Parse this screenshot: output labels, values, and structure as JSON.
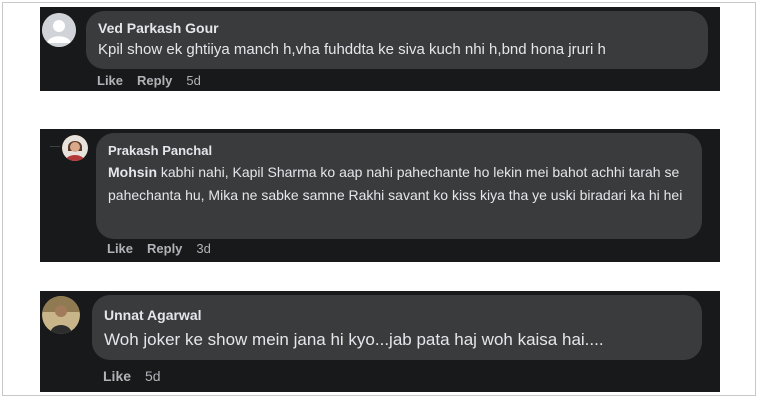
{
  "comments": [
    {
      "author": "Ved Parkash Gour",
      "text": "Kpil show ek ghtiiya manch h,vha fuhddta ke siva kuch nhi h,bnd hona jruri h",
      "like": "Like",
      "reply": "Reply",
      "time": "5d",
      "avatar_icon": "default-avatar-icon"
    },
    {
      "author": "Prakash Panchal",
      "mention": "Mohsin",
      "text": " kabhi nahi, Kapil Sharma ko aap nahi pahechante ho lekin mei bahot achhi tarah se pahechanta hu, Mika ne sabke samne Rakhi savant ko kiss kiya tha ye uski biradari ka hi hei",
      "like": "Like",
      "reply": "Reply",
      "time": "3d",
      "avatar_icon": "profile-photo-icon"
    },
    {
      "author": "Unnat Agarwal",
      "text": "Woh joker ke show mein jana hi kyo...jab pata haj woh kaisa hai....",
      "like": "Like",
      "time": "5d",
      "avatar_icon": "profile-photo-icon"
    }
  ],
  "colors": {
    "panel_bg": "#18191a",
    "bubble_bg": "#3a3b3c",
    "primary_text": "#e4e6eb",
    "secondary_text": "#b0b3b8"
  }
}
